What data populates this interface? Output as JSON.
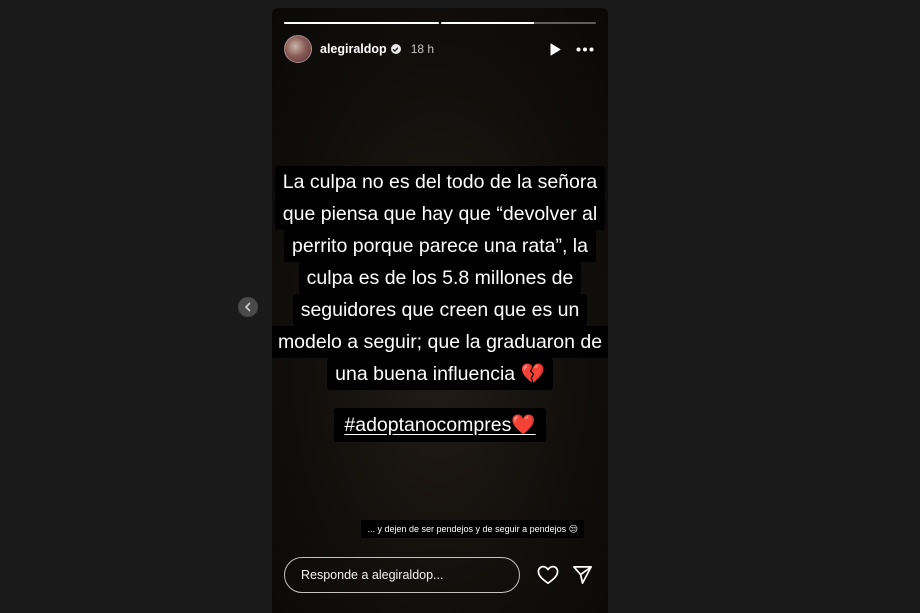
{
  "story": {
    "progress": [
      1.0,
      0.6
    ],
    "user": {
      "username": "alegiraldop",
      "time": "18 h",
      "verified": true
    },
    "text_lines": [
      "La culpa no es del todo de la señora",
      "que piensa que hay que “devolver al",
      "perrito porque parece una rata”, la",
      "culpa es de los 5.8 millones de",
      "seguidores que creen que es un",
      "modelo a seguir; que la graduaron de",
      "una buena influencia 💔"
    ],
    "hashtag": "#adoptanocompres❤️",
    "note": "... y dejen de ser pendejos y de seguir a pendejos 😒"
  },
  "reply": {
    "placeholder": "Responde a alegiraldop..."
  },
  "icons": {
    "play": "play-icon",
    "more": "more-options-icon",
    "like": "heart-icon",
    "share": "send-icon",
    "prev": "chevron-left-icon"
  },
  "colors": {
    "background": "#1a1a1a",
    "text": "#ffffff",
    "text_box": "#000000"
  }
}
